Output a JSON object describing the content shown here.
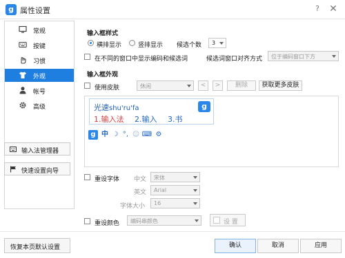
{
  "window": {
    "title": "属性设置",
    "logo_glyph": "g",
    "help_glyph": "?",
    "close_glyph": "✕"
  },
  "sidebar": {
    "items": [
      {
        "label": "常规",
        "icon": "monitor-icon"
      },
      {
        "label": "按键",
        "icon": "keyboard-icon"
      },
      {
        "label": "习惯",
        "icon": "hand-icon"
      },
      {
        "label": "外观",
        "icon": "shirt-icon",
        "active": true
      },
      {
        "label": "帐号",
        "icon": "person-icon"
      },
      {
        "label": "高级",
        "icon": "gear-icon"
      }
    ],
    "manager_label": "输入法管理器",
    "guide_label": "快速设置向导"
  },
  "input_style": {
    "title": "输入框样式",
    "horizontal_label": "横排显示",
    "vertical_label": "竖排显示",
    "horizontal_selected": true,
    "candidate_count_label": "候选个数",
    "candidate_count_value": "3",
    "diff_window_label": "在不同的窗口中显示编码和候选词",
    "diff_window_checked": false,
    "align_label": "候选词窗口对齐方式",
    "align_value": "位于编码窗口下方"
  },
  "appearance": {
    "title": "输入框外观",
    "use_skin_label": "使用皮肤",
    "use_skin_checked": false,
    "skin_value": "休闲",
    "prev_glyph": "<",
    "next_glyph": ">",
    "delete_label": "删除",
    "get_more_label": "获取更多皮肤"
  },
  "preview": {
    "pinyin_head": "光速",
    "pinyin_tail": "shu'ru'fa",
    "candidates": [
      "1.输入法",
      "2.输入",
      "3.书"
    ],
    "logo_glyph": "g",
    "status": [
      "g",
      "中",
      "☽",
      "°,",
      "☺",
      "⌨",
      "⚙"
    ]
  },
  "font": {
    "reset_label": "重设字体",
    "reset_checked": false,
    "cn_label": "中文",
    "cn_value": "宋体",
    "en_label": "英文",
    "en_value": "Arial",
    "size_label": "字体大小",
    "size_value": "16"
  },
  "color": {
    "reset_label": "重设颜色",
    "reset_checked": false,
    "target_value": "编码串颜色",
    "set_label": "设 置"
  },
  "footer": {
    "restore_label": "恢复本页默认设置",
    "ok_label": "确认",
    "cancel_label": "取消",
    "apply_label": "应用"
  },
  "colors": {
    "accent": "#1f7fe0",
    "logo": "#2a86e8",
    "candidate_first": "#e03b3b",
    "candidate_other": "#2468c4"
  }
}
